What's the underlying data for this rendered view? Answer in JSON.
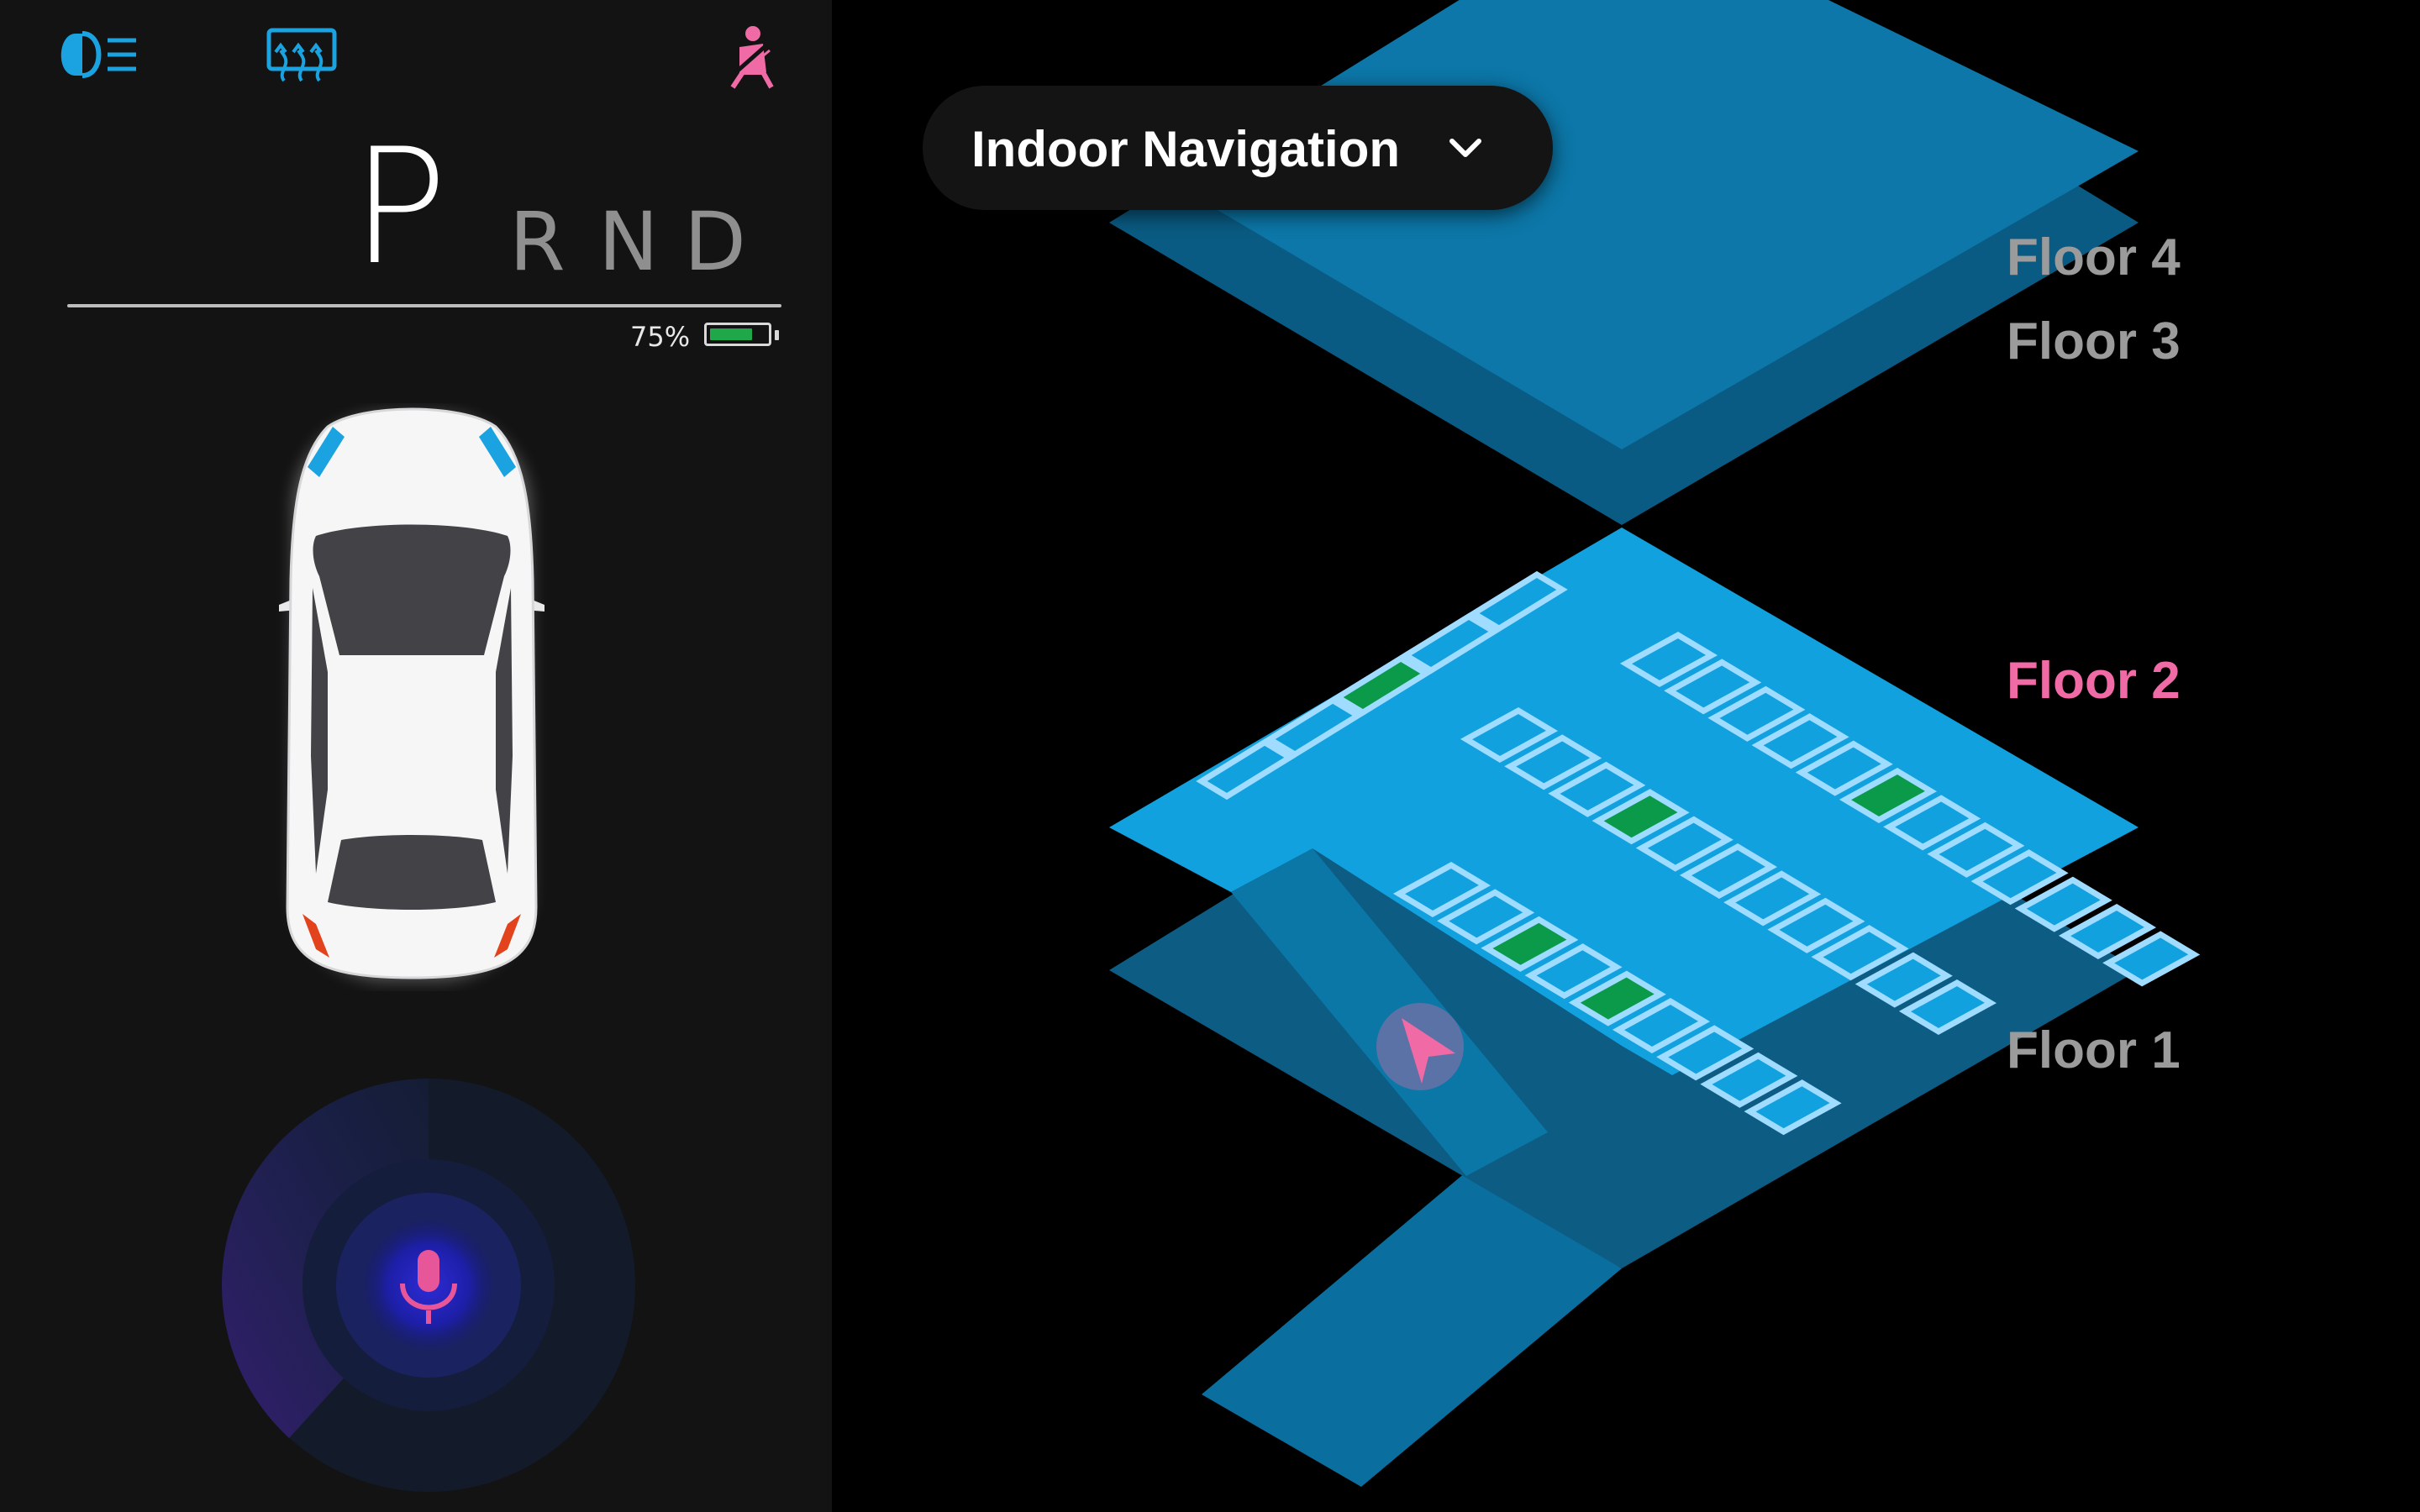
{
  "cluster": {
    "icons": [
      "headlight-icon",
      "rear-defrost-icon",
      "seatbelt-warning-icon"
    ],
    "gear": {
      "selected": "P",
      "others": [
        "R",
        "N",
        "D"
      ]
    },
    "battery": {
      "label": "75%",
      "level": 0.75,
      "color": "#1fa84a"
    },
    "voice": {
      "icon": "microphone-icon",
      "accent": "#e8569a"
    }
  },
  "navigation": {
    "mode_label": "Indoor Navigation",
    "floors": [
      {
        "label": "Floor 4",
        "active": false
      },
      {
        "label": "Floor 3",
        "active": false
      },
      {
        "label": "Floor 2",
        "active": true
      },
      {
        "label": "Floor 1",
        "active": false
      }
    ],
    "colors": {
      "active_floor": "#f06aa6",
      "inactive_floor": "#9b9b9b",
      "floor_fill": "#0e9ee0",
      "free_space": "#0a9a4a",
      "position_marker": "#f06aa6"
    }
  }
}
